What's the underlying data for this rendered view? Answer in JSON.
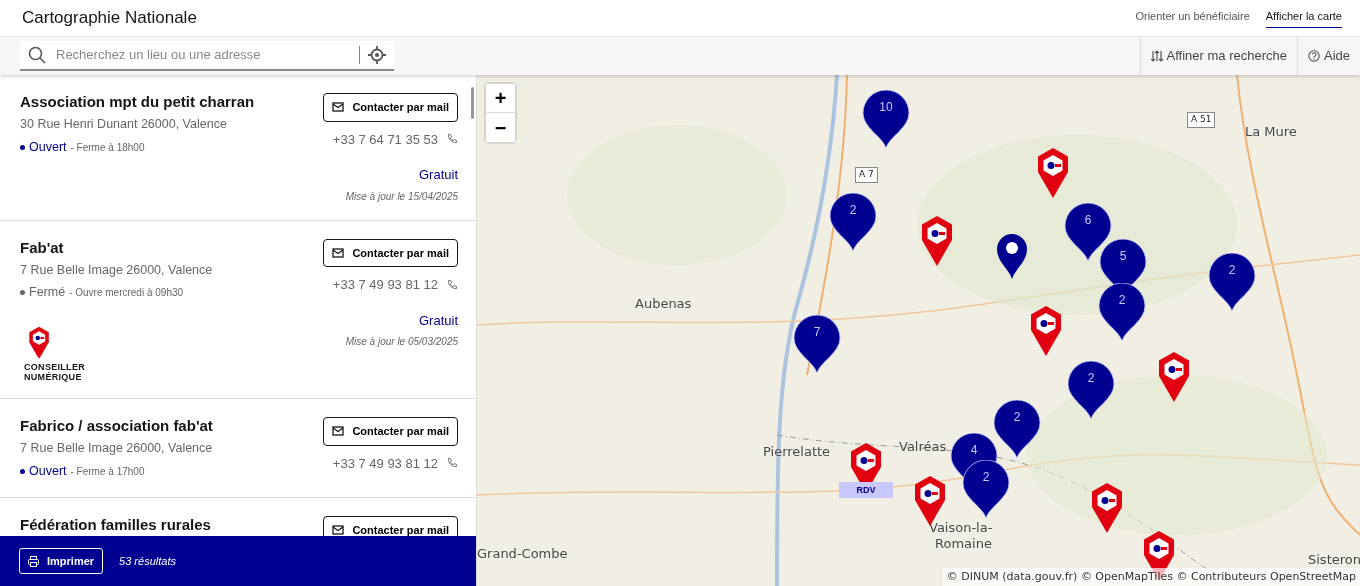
{
  "header": {
    "title": "Cartographie Nationale",
    "links": [
      {
        "label": "Orienter un bénéficiaire",
        "selected": false
      },
      {
        "label": "Afficher la carte",
        "selected": true
      }
    ]
  },
  "search": {
    "placeholder": "Recherchez un lieu ou une adresse"
  },
  "toolbar": {
    "filter_label": "Affiner ma recherche",
    "help_label": "Aide"
  },
  "places": [
    {
      "name": "Association mpt du petit charran",
      "address": "30 Rue Henri Dunant 26000, Valence",
      "open": true,
      "status": "Ouvert",
      "hours": "- Ferme à 18h00",
      "contact": "Contacter par mail",
      "phone": "+33 7 64 71 35 53",
      "price": "Gratuit",
      "updated": "Mise à jour le 15/04/2025"
    },
    {
      "name": "Fab'at",
      "address": "7 Rue Belle Image 26000, Valence",
      "open": false,
      "status": "Fermé",
      "hours": "- Ouvre mercredi à 09h30",
      "contact": "Contacter par mail",
      "phone": "+33 7 49 93 81 12",
      "price": "Gratuit",
      "updated": "Mise à jour le 05/03/2025",
      "label_lines": [
        "CONSEILLER",
        "NUMÉRIQUE"
      ]
    },
    {
      "name": "Fabrico / association fab'at",
      "address": "7 Rue Belle Image 26000, Valence",
      "open": true,
      "status": "Ouvert",
      "hours": "- Ferme à 17h00",
      "contact": "Contacter par mail",
      "phone": "+33 7 49 93 81 12"
    },
    {
      "name": "Fédération familles rurales",
      "contact": "Contacter par mail"
    }
  ],
  "footer": {
    "print_label": "Imprimer",
    "results": "53 résultats"
  },
  "map": {
    "zoom_in": "+",
    "zoom_out": "−",
    "places": [
      {
        "label": "Aubenas"
      },
      {
        "label": "Pierrelatte"
      },
      {
        "label": "Valréas"
      },
      {
        "label": "Vaison-la-"
      },
      {
        "label": "Romaine"
      },
      {
        "label": "Grand-Combe"
      },
      {
        "label": "Sisteron"
      },
      {
        "label": "La Mure"
      }
    ],
    "roads": [
      {
        "label": "A 51"
      },
      {
        "label": "A 7"
      }
    ],
    "markers": [
      {
        "kind": "cluster",
        "count": "10"
      },
      {
        "kind": "cluster",
        "count": "2"
      },
      {
        "kind": "advisor"
      },
      {
        "kind": "single"
      },
      {
        "kind": "advisor"
      },
      {
        "kind": "cluster",
        "count": "6"
      },
      {
        "kind": "cluster",
        "count": "5"
      },
      {
        "kind": "cluster",
        "count": "2"
      },
      {
        "kind": "cluster",
        "count": "2"
      },
      {
        "kind": "cluster",
        "count": "7"
      },
      {
        "kind": "advisor"
      },
      {
        "kind": "cluster",
        "count": "2"
      },
      {
        "kind": "advisor"
      },
      {
        "kind": "cluster",
        "count": "2"
      },
      {
        "kind": "cluster",
        "count": "4"
      },
      {
        "kind": "cluster",
        "count": "2"
      },
      {
        "kind": "advisor",
        "tag": "RDV"
      },
      {
        "kind": "advisor"
      },
      {
        "kind": "advisor"
      },
      {
        "kind": "advisor"
      }
    ],
    "attribution": "© DINUM (data.gouv.fr) © OpenMapTiles © Contributeurs OpenStreetMap"
  }
}
